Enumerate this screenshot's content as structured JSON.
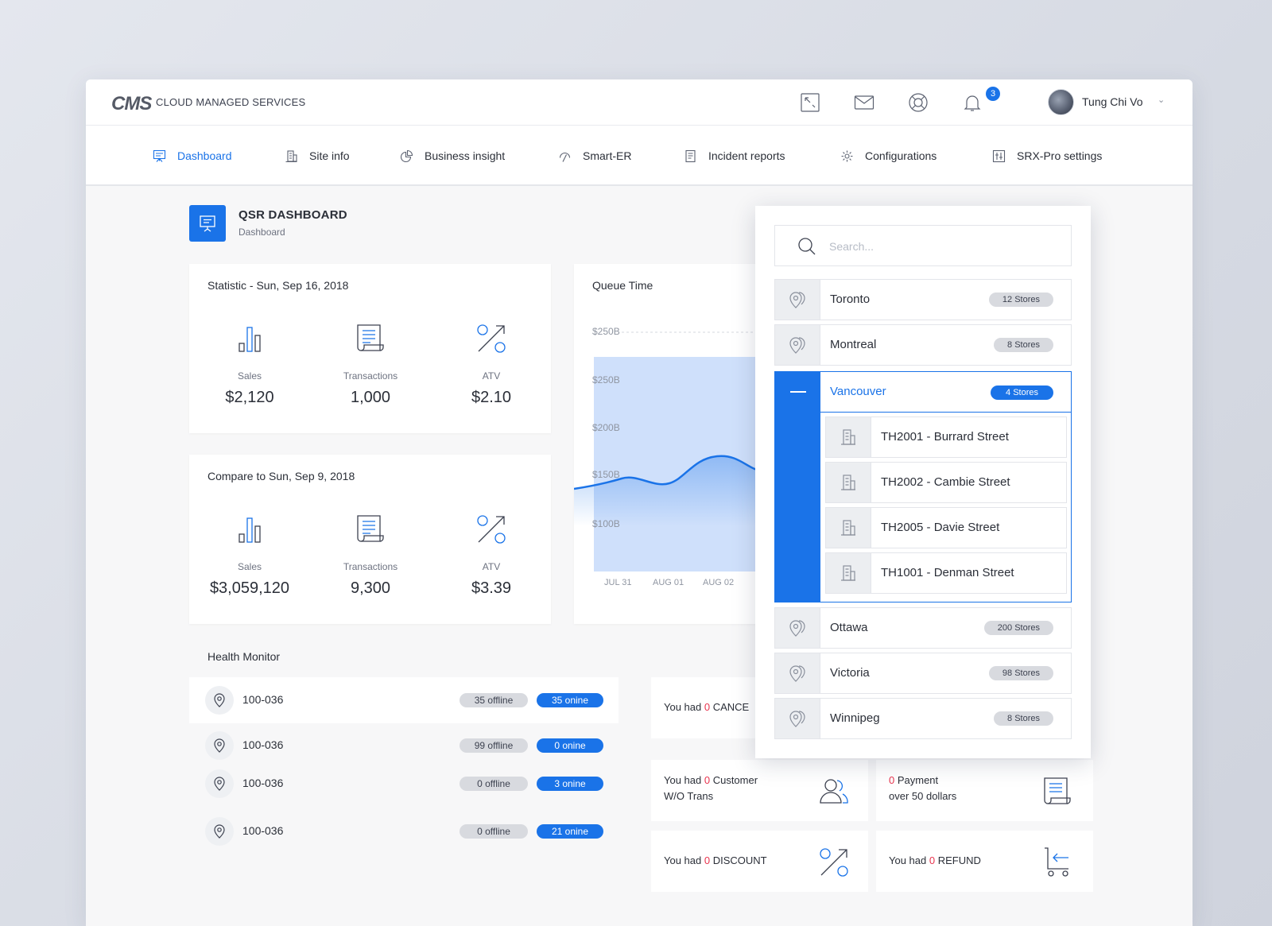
{
  "header": {
    "logo": "CMS",
    "brand": "CLOUD MANAGED SERVICES",
    "notifications_count": "3",
    "user_name": "Tung Chi Vo"
  },
  "nav": {
    "items": [
      {
        "label": "Dashboard",
        "icon": "presentation-icon",
        "active": true
      },
      {
        "label": "Site info",
        "icon": "building-icon"
      },
      {
        "label": "Business insight",
        "icon": "pie-chart-icon"
      },
      {
        "label": "Smart-ER",
        "icon": "gauge-icon"
      },
      {
        "label": "Incident reports",
        "icon": "report-icon"
      },
      {
        "label": "Configurations",
        "icon": "gear-icon"
      },
      {
        "label": "SRX-Pro settings",
        "icon": "settings-grid-icon"
      }
    ]
  },
  "page": {
    "title": "QSR DASHBOARD",
    "breadcrumb": "Dashboard"
  },
  "statistic": {
    "title": "Statistic - Sun, Sep 16, 2018",
    "items": [
      {
        "label": "Sales",
        "value": "$2,120"
      },
      {
        "label": "Transactions",
        "value": "1,000"
      },
      {
        "label": "ATV",
        "value": "$2.10"
      }
    ]
  },
  "compare": {
    "title": "Compare to Sun, Sep 9, 2018",
    "items": [
      {
        "label": "Sales",
        "value": "$3,059,120"
      },
      {
        "label": "Transactions",
        "value": "9,300"
      },
      {
        "label": "ATV",
        "value": "$3.39"
      }
    ]
  },
  "queue": {
    "title": "Queue Time",
    "y_ticks": [
      "$250B",
      "$250B",
      "$200B",
      "$150B",
      "$100B"
    ],
    "x_ticks": [
      "JUL 31",
      "AUG 01",
      "AUG 02"
    ]
  },
  "health_monitor": {
    "title": "Health Monitor",
    "rows": [
      {
        "id": "100-036",
        "offline": "35 offline",
        "online": "35 onine"
      },
      {
        "id": "100-036",
        "offline": "99 offline",
        "online": "0 onine"
      },
      {
        "id": "100-036",
        "offline": "0 offline",
        "online": "3 onine"
      },
      {
        "id": "100-036",
        "offline": "0 offline",
        "online": "21 onine"
      }
    ]
  },
  "alerts": {
    "cancel": {
      "prefix": "You had ",
      "count": "0",
      "suffix": " CANCE"
    },
    "customer": {
      "prefix": "You had ",
      "count": "0",
      "suffix": " Customer",
      "line2": "W/O Trans"
    },
    "payment": {
      "count": "0",
      "suffix": " Payment",
      "line2": "over 50 dollars"
    },
    "discount": {
      "prefix": "You had ",
      "count": "0",
      "suffix": " DISCOUNT"
    },
    "refund": {
      "prefix": "You had ",
      "count": "0",
      "suffix": " REFUND"
    }
  },
  "dropdown": {
    "search_placeholder": "Search...",
    "locations_top": [
      {
        "name": "Toronto",
        "count": "12 Stores"
      },
      {
        "name": "Montreal",
        "count": "8 Stores"
      }
    ],
    "expanded": {
      "name": "Vancouver",
      "count": "4 Stores",
      "stores": [
        "TH2001 - Burrard Street",
        "TH2002 - Cambie Street",
        "TH2005 - Davie Street",
        "TH1001 - Denman Street"
      ]
    },
    "locations_bottom": [
      {
        "name": "Ottawa",
        "count": "200 Stores"
      },
      {
        "name": "Victoria",
        "count": "98 Stores"
      },
      {
        "name": "Winnipeg",
        "count": "8 Stores"
      }
    ]
  },
  "colors": {
    "accent": "#1a73e8",
    "alert_zero": "#e8344e"
  }
}
